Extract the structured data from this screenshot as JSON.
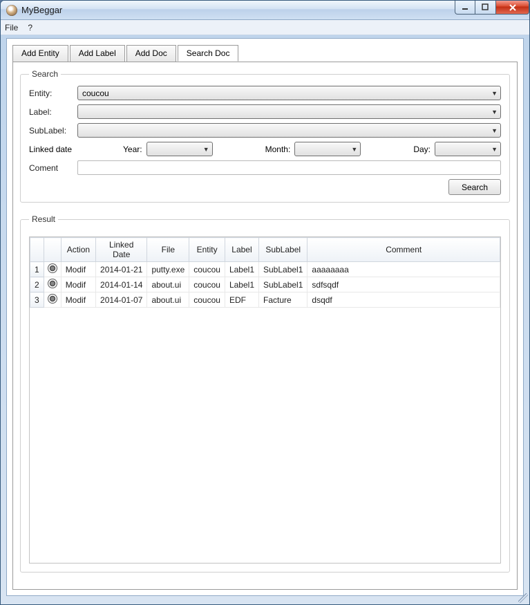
{
  "window": {
    "title": "MyBeggar"
  },
  "menubar": {
    "file": "File",
    "help": "?"
  },
  "tabs": {
    "add_entity": "Add Entity",
    "add_label": "Add Label",
    "add_doc": "Add Doc",
    "search_doc": "Search Doc"
  },
  "search": {
    "legend": "Search",
    "entity_label": "Entity:",
    "entity_value": "coucou",
    "label_label": "Label:",
    "label_value": "",
    "sublabel_label": "SubLabel:",
    "sublabel_value": "",
    "linked_date_label": "Linked date",
    "year_label": "Year:",
    "year_value": "",
    "month_label": "Month:",
    "month_value": "",
    "day_label": "Day:",
    "day_value": "",
    "coment_label": "Coment",
    "coment_value": "",
    "search_button": "Search"
  },
  "result": {
    "legend": "Result",
    "headers": {
      "action": "Action",
      "linked_date": "Linked Date",
      "file": "File",
      "entity": "Entity",
      "label": "Label",
      "sublabel": "SubLabel",
      "comment": "Comment"
    },
    "rows": [
      {
        "n": "1",
        "action": "Modif",
        "linked_date": "2014-01-21",
        "file": "putty.exe",
        "entity": "coucou",
        "label": "Label1",
        "sublabel": "SubLabel1",
        "comment": "aaaaaaaa"
      },
      {
        "n": "2",
        "action": "Modif",
        "linked_date": "2014-01-14",
        "file": "about.ui",
        "entity": "coucou",
        "label": "Label1",
        "sublabel": "SubLabel1",
        "comment": "sdfsqdf"
      },
      {
        "n": "3",
        "action": "Modif",
        "linked_date": "2014-01-07",
        "file": "about.ui",
        "entity": "coucou",
        "label": "EDF",
        "sublabel": "Facture",
        "comment": "dsqdf"
      }
    ]
  }
}
